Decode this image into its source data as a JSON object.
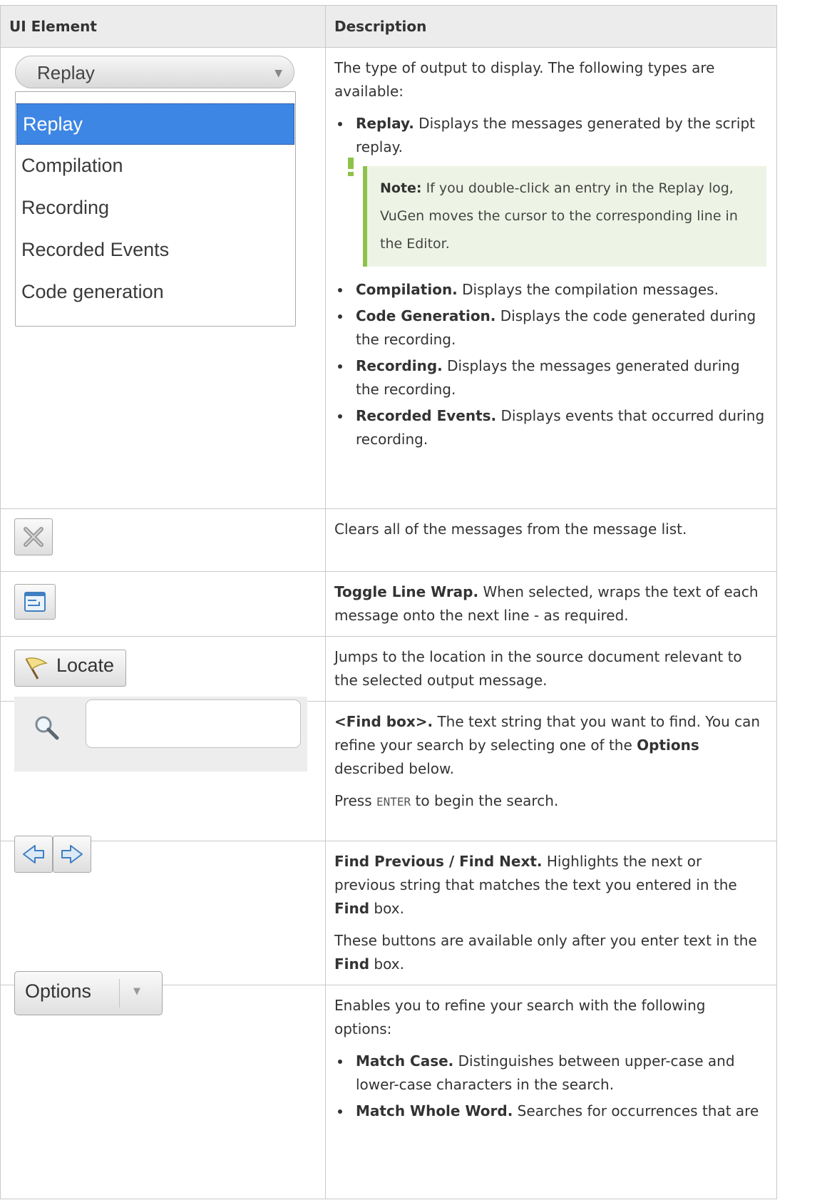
{
  "headers": {
    "ui_element": "UI Element",
    "description": "Description"
  },
  "output_type": {
    "selected": "Replay",
    "options": [
      "Replay",
      "Compilation",
      "Recording",
      "Recorded Events",
      "Code generation"
    ],
    "intro": "The type of output to display. The following types are available:",
    "items": [
      {
        "term": "Replay.",
        "text": " Displays the messages generated by the script replay."
      },
      {
        "term": "Compilation.",
        "text": " Displays the compilation messages."
      },
      {
        "term": "Code Generation.",
        "text": " Displays the code generated during the recording."
      },
      {
        "term": "Recording.",
        "text": " Displays the messages generated during the recording."
      },
      {
        "term": "Recorded Events.",
        "text": " Displays events that occurred during recording."
      }
    ],
    "note_label": "Note:",
    "note_text": " If you double-click an entry in the Replay log, VuGen moves the cursor to the corresponding line in the Editor."
  },
  "clear": {
    "desc": "Clears all of the messages from the message list."
  },
  "wrap": {
    "term": "Toggle Line Wrap.",
    "text": " When selected, wraps the text of each message onto the next line - as required."
  },
  "locate": {
    "label": "Locate",
    "desc": "Jumps to the location in the source document relevant to the selected output message."
  },
  "find": {
    "term": "<Find box>.",
    "t1": " The text string that you want to find. You can refine your search by selecting one of the ",
    "options_word": "Options",
    "t2": " described below.",
    "press": "Press ",
    "key": "ENTER",
    "press_after": " to begin the search."
  },
  "prevnext": {
    "term": "Find Previous / Find Next.",
    "t1": " Highlights the next or previous string that matches the text you entered in the ",
    "find_word": "Find",
    "t2": " box.",
    "t3": "These buttons are available only after you enter text in the ",
    "find_word2": "Find",
    "t4": " box."
  },
  "options": {
    "label": "Options",
    "intro": "Enables you to refine your search with the following options:",
    "items": [
      {
        "term": "Match Case.",
        "text": " Distinguishes between upper-case and lower-case characters in the search."
      },
      {
        "term": "Match Whole Word.",
        "text": " Searches for occurrences that are"
      }
    ]
  },
  "colors": {
    "accent_select": "#3d86e4",
    "note_bg": "#eef4e5",
    "note_border": "#8fc24a",
    "header_bg": "#ececec"
  },
  "icons": [
    "clear-icon",
    "line-wrap-icon",
    "flag-icon",
    "search-icon",
    "arrow-left-icon",
    "arrow-right-icon",
    "chevron-down-icon",
    "exclamation-icon"
  ]
}
